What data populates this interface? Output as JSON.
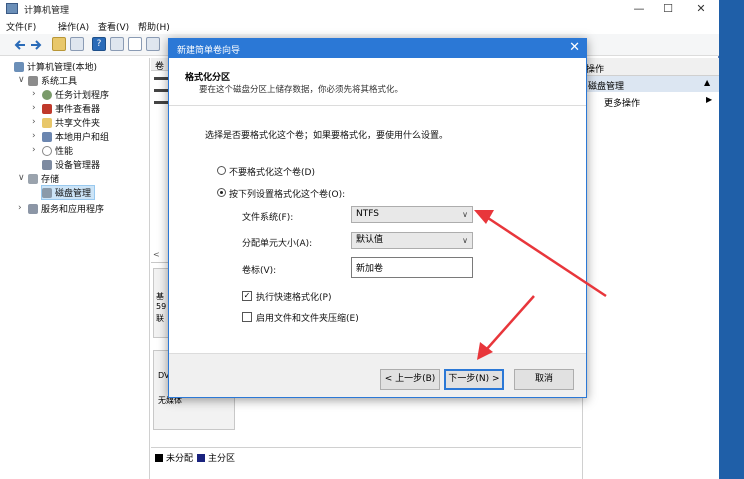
{
  "colors": {
    "accent": "#2b78d6",
    "annotation": "#e8363b",
    "unallocated": "#000000",
    "primary_partition": "#1a237e"
  },
  "window": {
    "title": "计算机管理",
    "min": "—",
    "max": "☐",
    "close": "✕"
  },
  "menu": [
    "文件(F)",
    "操作(A)",
    "查看(V)",
    "帮助(H)"
  ],
  "tree": {
    "root": "计算机管理(本地)",
    "system_tools": "系统工具",
    "task_scheduler": "任务计划程序",
    "event_viewer": "事件查看器",
    "shared_folders": "共享文件夹",
    "local_users": "本地用户和组",
    "performance": "性能",
    "device_manager": "设备管理器",
    "storage": "存储",
    "disk_management": "磁盘管理",
    "services": "服务和应用程序"
  },
  "middle": {
    "col_vol": "卷",
    "col_layout": "布",
    "disk_lines": [
      "基",
      "59",
      "联"
    ],
    "dvd_label": "DV",
    "no_media": "无媒体",
    "legend_unallocated": "未分配",
    "legend_primary": "主分区"
  },
  "actions": {
    "header": "操作",
    "sub": "磁盘管理",
    "more": "更多操作"
  },
  "dialog": {
    "title": "新建简单卷向导",
    "heading": "格式化分区",
    "subheading": "要在这个磁盘分区上储存数据，你必须先将其格式化。",
    "instruction": "选择是否要格式化这个卷；如果要格式化，要使用什么设置。",
    "radio_no_format": "不要格式化这个卷(D)",
    "radio_format": "按下列设置格式化这个卷(O):",
    "fs_label": "文件系统(F):",
    "fs_value": "NTFS",
    "alloc_label": "分配单元大小(A):",
    "alloc_value": "默认值",
    "vol_label": "卷标(V):",
    "vol_value": "新加卷",
    "quick_format": "执行快速格式化(P)",
    "compression": "启用文件和文件夹压缩(E)",
    "back": "< 上一步(B)",
    "next": "下一步(N) >",
    "cancel": "取消"
  }
}
